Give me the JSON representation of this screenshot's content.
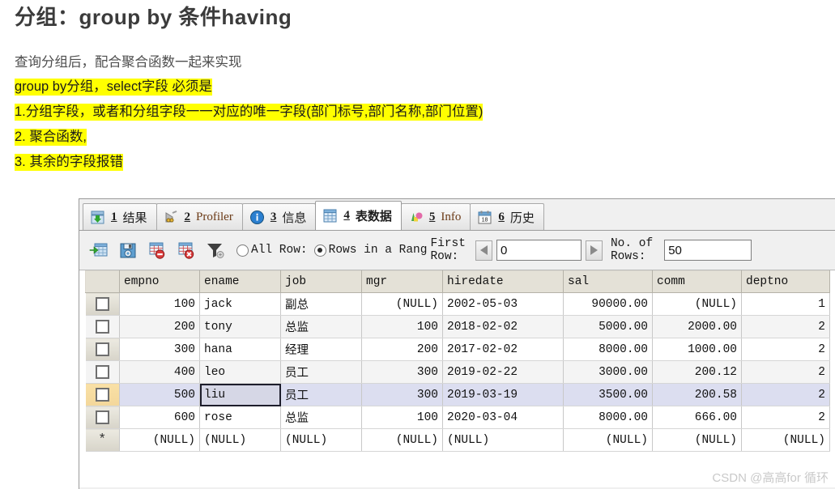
{
  "article": {
    "title": "分组：group by 条件having",
    "lines": [
      {
        "text": "查询分组后，配合聚合函数一起来实现",
        "highlight": false
      },
      {
        "text": "group by分组，select字段 必须是",
        "highlight": true
      },
      {
        "text": "1.分组字段，或者和分组字段一一对应的唯一字段(部门标号,部门名称,部门位置)",
        "highlight": true
      },
      {
        "text": "2. 聚合函数,",
        "highlight": true
      },
      {
        "text": "3. 其余的字段报错",
        "highlight": true
      }
    ]
  },
  "tabs": [
    {
      "num": "1",
      "label": "结果",
      "icon": "grid-download-icon",
      "active": false,
      "latin": false
    },
    {
      "num": "2",
      "label": "Profiler",
      "icon": "profiler-icon",
      "active": false,
      "latin": true
    },
    {
      "num": "3",
      "label": "信息",
      "icon": "info-blue-icon",
      "active": false,
      "latin": false
    },
    {
      "num": "4",
      "label": "表数据",
      "icon": "table-grid-icon",
      "active": true,
      "latin": false
    },
    {
      "num": "5",
      "label": "Info",
      "icon": "chart-colors-icon",
      "active": false,
      "latin": true
    },
    {
      "num": "6",
      "label": "历史",
      "icon": "calendar-icon",
      "active": false,
      "latin": false
    }
  ],
  "toolbar": {
    "buttons": [
      {
        "name": "add-record-button",
        "icon": "grid-plus-icon"
      },
      {
        "name": "save-record-button",
        "icon": "floppy-save-icon"
      },
      {
        "name": "delete-record-button",
        "icon": "grid-stop-icon"
      },
      {
        "name": "cancel-record-button",
        "icon": "grid-cancel-icon"
      },
      {
        "name": "filter-button",
        "icon": "funnel-icon"
      }
    ],
    "radio_all_row": {
      "label": "All Row:",
      "checked": false
    },
    "radio_rows_in_range": {
      "label": "Rows in a Rang",
      "checked": true
    },
    "first_row_label_1": "First",
    "first_row_label_2": "Row:",
    "first_row_value": "0",
    "prev_arrow": "left-triangle-icon",
    "next_arrow": "right-triangle-icon",
    "no_of_rows_label_1": "No. of",
    "no_of_rows_label_2": "Rows:",
    "no_of_rows_value": "50"
  },
  "grid": {
    "columns": [
      "empno",
      "ename",
      "job",
      "mgr",
      "hiredate",
      "sal",
      "comm",
      "deptno"
    ],
    "highlighted_column": "ename",
    "selected_row_index": 4,
    "active_cell": {
      "row": 4,
      "column": "ename"
    },
    "rows": [
      {
        "empno": "100",
        "ename": "jack",
        "job": "副总",
        "mgr": "(NULL)",
        "hiredate": "2002-05-03",
        "sal": "90000.00",
        "comm": "(NULL)",
        "deptno": "1"
      },
      {
        "empno": "200",
        "ename": "tony",
        "job": "总监",
        "mgr": "100",
        "hiredate": "2018-02-02",
        "sal": "5000.00",
        "comm": "2000.00",
        "deptno": "2"
      },
      {
        "empno": "300",
        "ename": "hana",
        "job": "经理",
        "mgr": "200",
        "hiredate": "2017-02-02",
        "sal": "8000.00",
        "comm": "1000.00",
        "deptno": "2"
      },
      {
        "empno": "400",
        "ename": "leo",
        "job": "员工",
        "mgr": "300",
        "hiredate": "2019-02-22",
        "sal": "3000.00",
        "comm": "200.12",
        "deptno": "2"
      },
      {
        "empno": "500",
        "ename": "liu",
        "job": "员工",
        "mgr": "300",
        "hiredate": "2019-03-19",
        "sal": "3500.00",
        "comm": "200.58",
        "deptno": "2"
      },
      {
        "empno": "600",
        "ename": "rose",
        "job": "总监",
        "mgr": "100",
        "hiredate": "2020-03-04",
        "sal": "8000.00",
        "comm": "666.00",
        "deptno": "2"
      }
    ],
    "new_row": {
      "marker": "*",
      "empno": "(NULL)",
      "ename": "(NULL)",
      "job": "(NULL)",
      "mgr": "(NULL)",
      "hiredate": "(NULL)",
      "sal": "(NULL)",
      "comm": "(NULL)",
      "deptno": "(NULL)"
    }
  },
  "watermark": "CSDN @高高for 循环"
}
